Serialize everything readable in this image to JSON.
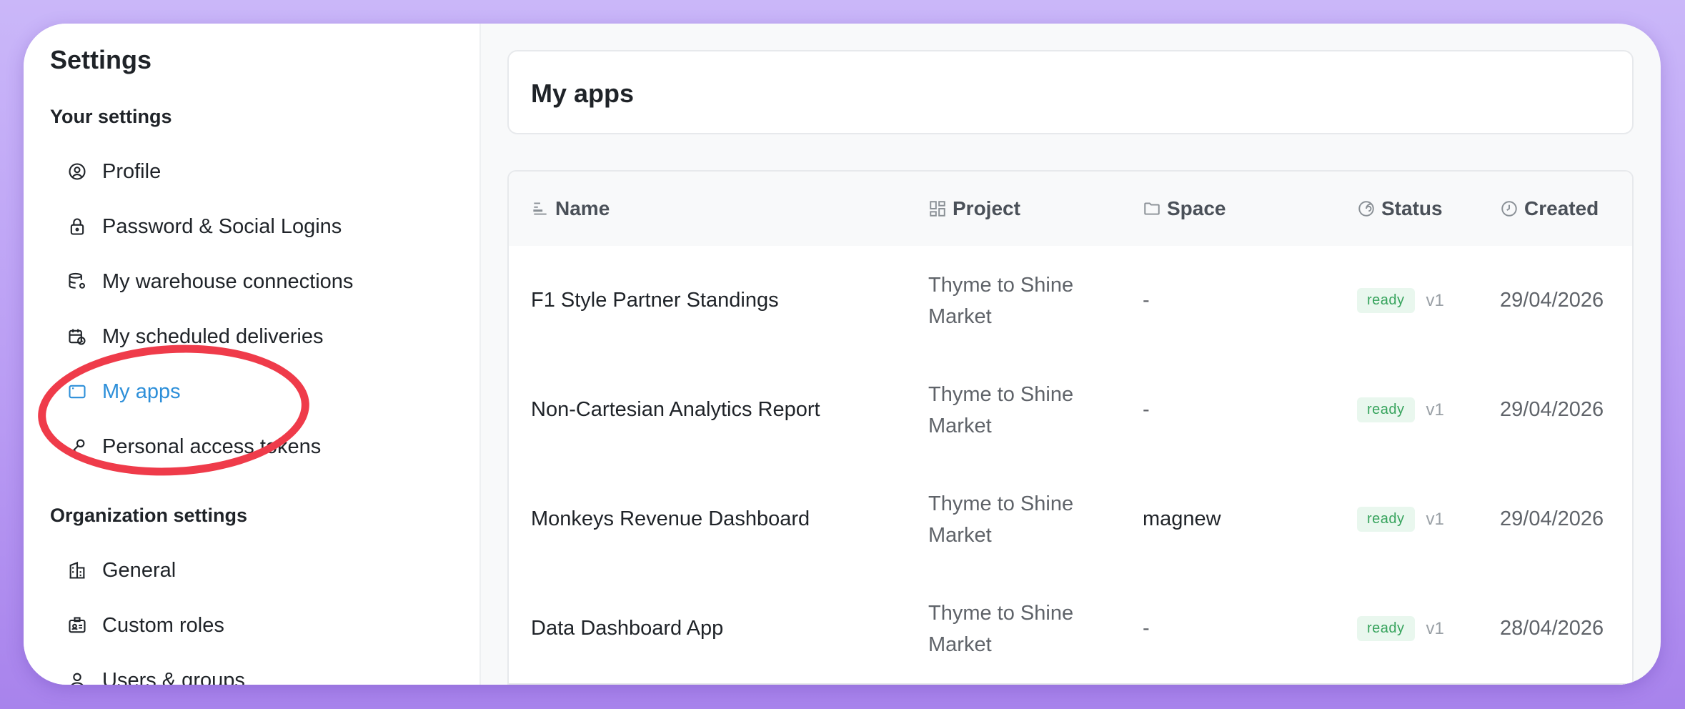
{
  "sidebar": {
    "title": "Settings",
    "your_settings_heading": "Your settings",
    "your_items": [
      {
        "label": "Profile",
        "icon": "profile-icon"
      },
      {
        "label": "Password & Social Logins",
        "icon": "lock-icon"
      },
      {
        "label": "My warehouse connections",
        "icon": "database-gear-icon"
      },
      {
        "label": "My scheduled deliveries",
        "icon": "calendar-clock-icon"
      },
      {
        "label": "My apps",
        "icon": "app-window-icon",
        "active": true
      },
      {
        "label": "Personal access tokens",
        "icon": "key-icon"
      }
    ],
    "org_settings_heading": "Organization settings",
    "org_items": [
      {
        "label": "General",
        "icon": "building-icon"
      },
      {
        "label": "Custom roles",
        "icon": "id-card-icon"
      },
      {
        "label": "Users & groups",
        "icon": "user-icon"
      }
    ]
  },
  "main": {
    "title": "My apps",
    "columns": [
      {
        "label": "Name",
        "icon": "text-align-icon"
      },
      {
        "label": "Project",
        "icon": "grid-icon"
      },
      {
        "label": "Space",
        "icon": "folder-icon"
      },
      {
        "label": "Status",
        "icon": "signal-icon"
      },
      {
        "label": "Created",
        "icon": "clock-icon"
      }
    ],
    "rows": [
      {
        "name": "F1 Style Partner Standings",
        "project": "Thyme to Shine Market",
        "space": "-",
        "status": "ready",
        "version": "v1",
        "created": "29/04/2026"
      },
      {
        "name": "Non-Cartesian Analytics Report",
        "project": "Thyme to Shine Market",
        "space": "-",
        "status": "ready",
        "version": "v1",
        "created": "29/04/2026"
      },
      {
        "name": "Monkeys Revenue Dashboard",
        "project": "Thyme to Shine Market",
        "space": "magnew",
        "status": "ready",
        "version": "v1",
        "created": "29/04/2026"
      },
      {
        "name": "Data Dashboard App",
        "project": "Thyme to Shine Market",
        "space": "-",
        "status": "ready",
        "version": "v1",
        "created": "28/04/2026"
      }
    ]
  },
  "colors": {
    "accent": "#2d8fd9",
    "annotation_circle": "#ef3b4a",
    "ready_badge_bg": "#e9f7ee",
    "ready_badge_text": "#36a35c"
  }
}
